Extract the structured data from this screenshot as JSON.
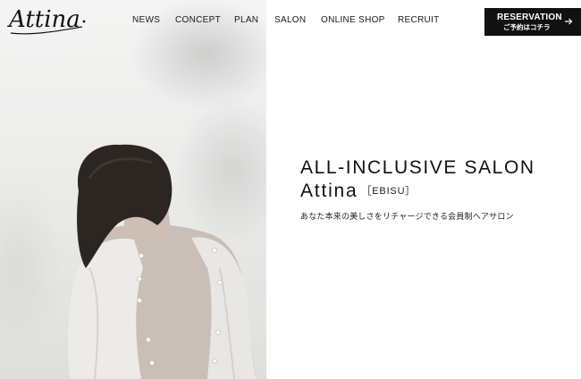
{
  "header": {
    "logo_text": "Attina",
    "nav": [
      {
        "label": "NEWS"
      },
      {
        "label": "CONCEPT"
      },
      {
        "label": "PLAN"
      },
      {
        "label": "SALON"
      },
      {
        "label": "ONLINE SHOP"
      },
      {
        "label": "RECRUIT"
      }
    ],
    "reservation": {
      "title": "RESERVATION",
      "subtitle": "ご予約はコチラ",
      "icon": "arrow-right-icon"
    }
  },
  "hero": {
    "image": "woman-with-bob-haircut-back-view-photo",
    "heading": "ALL-INCLUSIVE SALON",
    "brand": "Attina",
    "location": "［EBISU］",
    "tagline": "あなた本来の美しさをリチャージできる会員制ヘアサロン"
  },
  "colors": {
    "text": "#111111",
    "button_bg": "#111111",
    "button_text": "#ffffff",
    "background": "#ffffff"
  }
}
